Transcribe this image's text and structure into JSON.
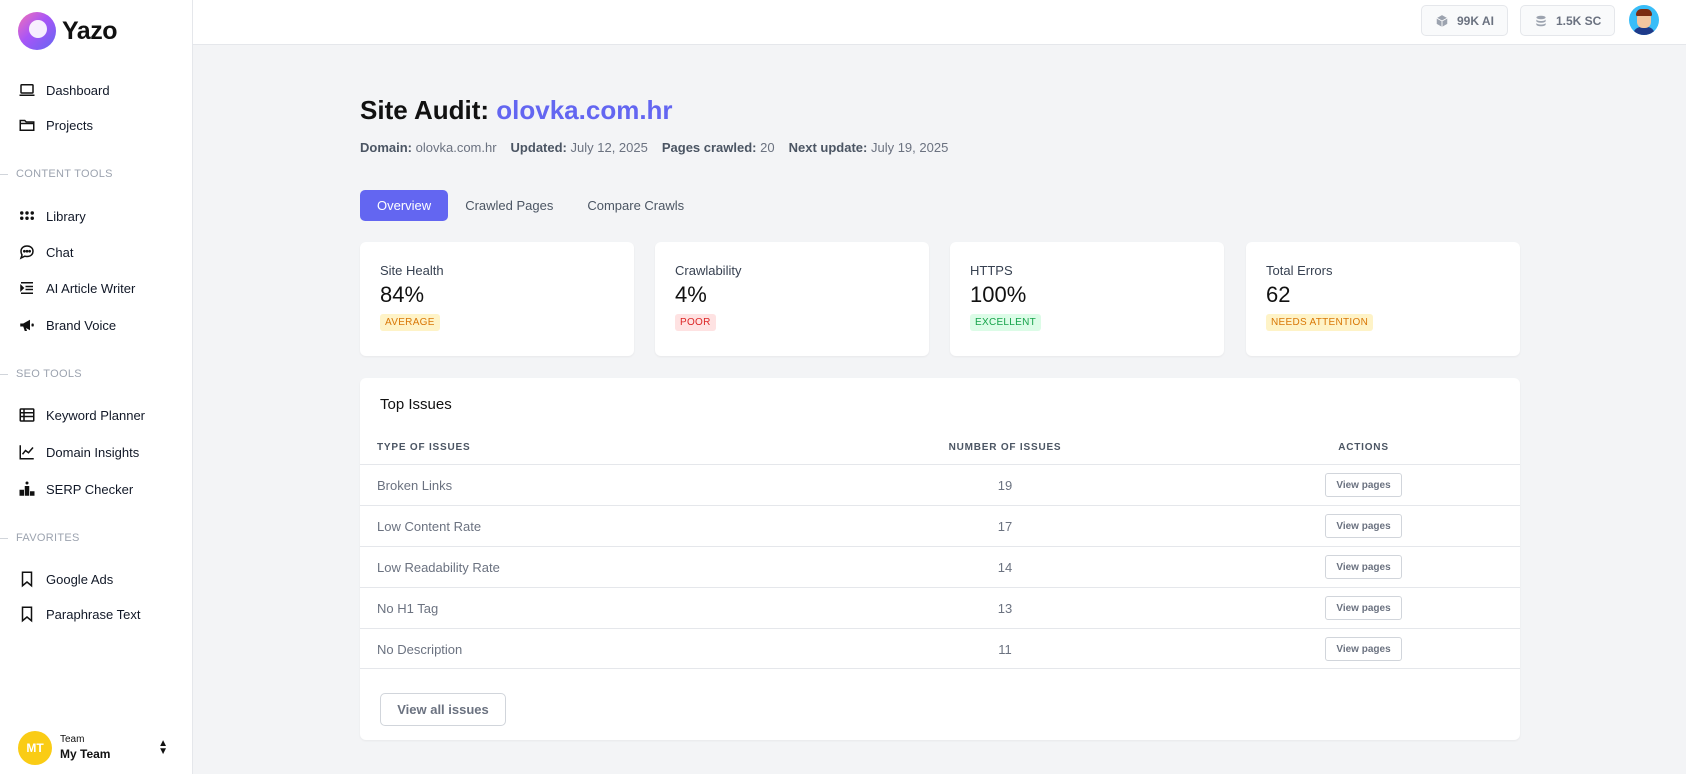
{
  "app": {
    "name": "Yazo"
  },
  "sidebar": {
    "items_top": [
      {
        "label": "Dashboard",
        "icon": "laptop-icon"
      },
      {
        "label": "Projects",
        "icon": "folder-icon"
      }
    ],
    "content_tools": {
      "label": "CONTENT TOOLS",
      "items": [
        {
          "label": "Library",
          "icon": "grid-icon"
        },
        {
          "label": "Chat",
          "icon": "chat-icon"
        },
        {
          "label": "AI Article Writer",
          "icon": "indent-icon"
        },
        {
          "label": "Brand Voice",
          "icon": "megaphone-icon"
        }
      ]
    },
    "seo_tools": {
      "label": "SEO TOOLS",
      "items": [
        {
          "label": "Keyword Planner",
          "icon": "table-icon"
        },
        {
          "label": "Domain Insights",
          "icon": "line-chart-icon"
        },
        {
          "label": "SERP Checker",
          "icon": "podium-icon"
        }
      ]
    },
    "favorites": {
      "label": "FAVORITES",
      "items": [
        {
          "label": "Google Ads",
          "icon": "bookmark-icon"
        },
        {
          "label": "Paraphrase Text",
          "icon": "bookmark-icon"
        }
      ]
    },
    "team": {
      "initials": "MT",
      "label": "Team",
      "name": "My Team"
    }
  },
  "topbar": {
    "ai_credits": "99K AI",
    "sc_credits": "1.5K SC"
  },
  "page": {
    "title_prefix": "Site Audit:",
    "title_domain": "olovka.com.hr",
    "meta": {
      "domain_label": "Domain:",
      "domain_value": "olovka.com.hr",
      "updated_label": "Updated:",
      "updated_value": "July 12, 2025",
      "pages_label": "Pages crawled:",
      "pages_value": "20",
      "next_label": "Next update:",
      "next_value": "July 19, 2025"
    },
    "tabs": [
      "Overview",
      "Crawled Pages",
      "Compare Crawls"
    ]
  },
  "cards": [
    {
      "label": "Site Health",
      "value": "84%",
      "badge": "AVERAGE",
      "badge_bg": "#fef3c7",
      "badge_color": "#d97706"
    },
    {
      "label": "Crawlability",
      "value": "4%",
      "badge": "POOR",
      "badge_bg": "#fee2e2",
      "badge_color": "#dc2626"
    },
    {
      "label": "HTTPS",
      "value": "100%",
      "badge": "EXCELLENT",
      "badge_bg": "#dcfce7",
      "badge_color": "#16a34a"
    },
    {
      "label": "Total Errors",
      "value": "62",
      "badge": "NEEDS ATTENTION",
      "badge_bg": "#fef3c7",
      "badge_color": "#d97706"
    }
  ],
  "issues": {
    "title": "Top Issues",
    "headers": {
      "type": "TYPE OF ISSUES",
      "number": "NUMBER OF ISSUES",
      "actions": "ACTIONS"
    },
    "rows": [
      {
        "name": "Broken Links",
        "count": "19",
        "action": "View pages"
      },
      {
        "name": "Low Content Rate",
        "count": "17",
        "action": "View pages"
      },
      {
        "name": "Low Readability Rate",
        "count": "14",
        "action": "View pages"
      },
      {
        "name": "No H1 Tag",
        "count": "13",
        "action": "View pages"
      },
      {
        "name": "No Description",
        "count": "11",
        "action": "View pages"
      }
    ],
    "view_all": "View all issues"
  },
  "colors": {
    "accent": "#6366f1"
  }
}
